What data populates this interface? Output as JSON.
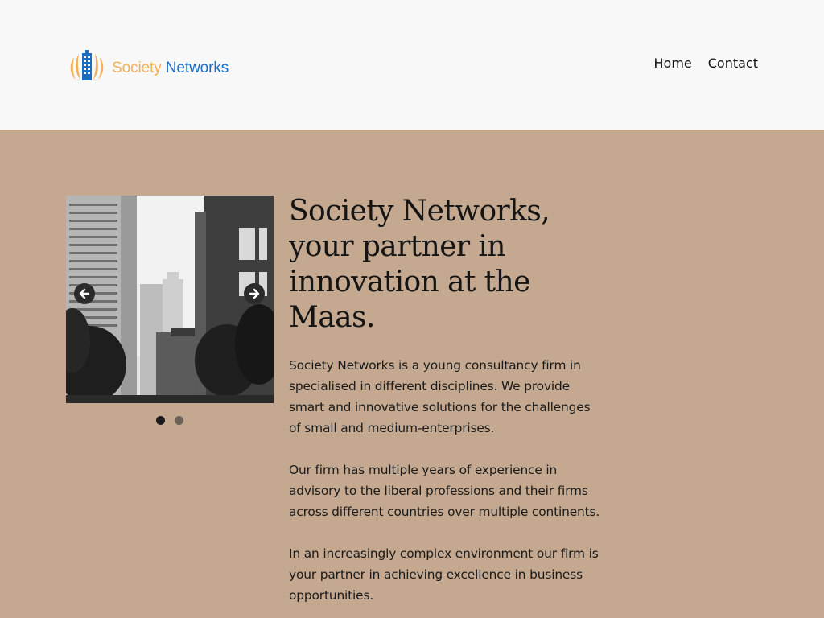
{
  "brand": {
    "name_part1": "Society",
    "name_part2": "Networks",
    "color_primary": "#1c6dc2",
    "color_secondary": "#f3b05a"
  },
  "nav": {
    "items": [
      {
        "label": "Home"
      },
      {
        "label": "Contact"
      }
    ]
  },
  "hero": {
    "background_color": "#c4a990",
    "headline": "Society Networks, your partner in innovation at the Maas.",
    "paragraphs": [
      "Society Networks is a young consultancy firm in specialised in different disciplines. We provide smart and innovative solutions for the challenges of small and medium-enterprises.",
      "Our firm has multiple years of experience in advisory to the liberal professions and their firms across different countries over multiple continents.",
      "In an increasingly complex environment our firm is your partner in achieving excellence in business opportunities."
    ]
  },
  "slider": {
    "slide_count": 2,
    "active_index": 0,
    "prev_icon": "arrow-left-icon",
    "next_icon": "arrow-right-icon"
  }
}
